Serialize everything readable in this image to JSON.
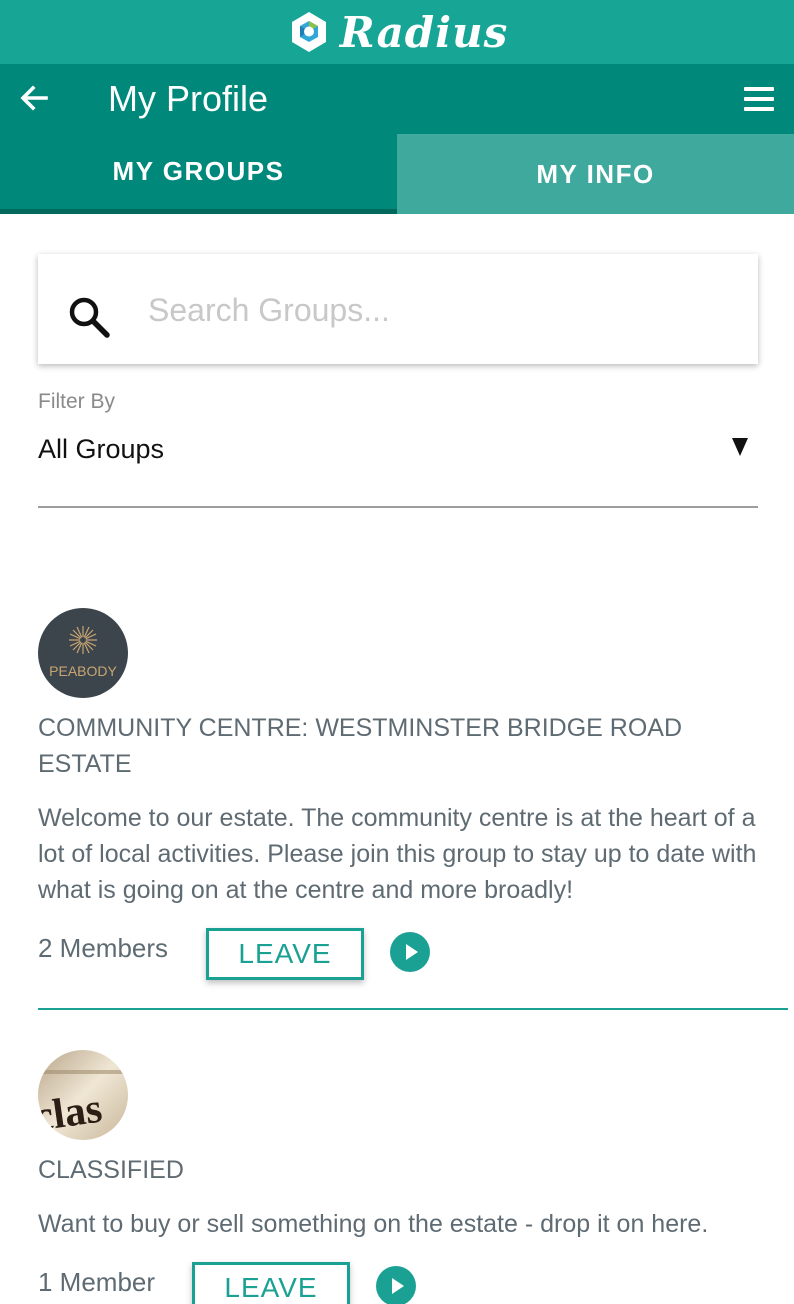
{
  "brand": {
    "name": "Radius",
    "logo_icon": "hexagon-logo-icon",
    "bar_color": "#17a596"
  },
  "header": {
    "title": "My Profile",
    "back_icon": "arrow-left-icon",
    "menu_icon": "hamburger-menu-icon",
    "color": "#00897b"
  },
  "tabs": [
    {
      "label": "MY GROUPS",
      "active": true
    },
    {
      "label": "MY INFO",
      "active": false
    }
  ],
  "search": {
    "placeholder": "Search Groups...",
    "value": "",
    "icon": "search-icon"
  },
  "filter": {
    "label": "Filter By",
    "selected": "All Groups"
  },
  "groups": [
    {
      "avatar_text": "PEABODY",
      "title": "COMMUNITY CENTRE: WESTMINSTER BRIDGE ROAD ESTATE",
      "description": "Welcome to our estate. The community centre is at the heart of a lot of local activities. Please join this group to stay up to date with what is going on at the centre and more broadly!",
      "members": "2 Members",
      "action_label": "LEAVE"
    },
    {
      "avatar_text": "clas",
      "title": "CLASSIFIED",
      "description": "Want to buy or sell something on the estate - drop it on here.",
      "members": "1 Member",
      "action_label": "LEAVE"
    }
  ],
  "accent_color": "#1ba193"
}
